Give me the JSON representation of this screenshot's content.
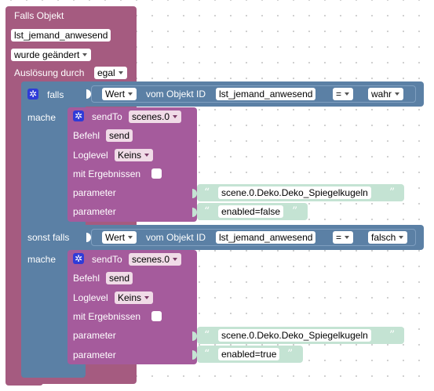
{
  "trigger": {
    "title": "Falls Objekt",
    "object_id": "lst_jemand_anwesend",
    "condition": "wurde geändert",
    "trigger_label": "Auslösung durch",
    "trigger_value": "egal"
  },
  "if_block": {
    "if_label": "falls",
    "do_label": "mache",
    "elseif_label": "sonst falls",
    "gear_symbol": "✲"
  },
  "cond1": {
    "property": "Wert",
    "of_object": "vom Objekt ID",
    "object_id": "lst_jemand_anwesend",
    "operator": "=",
    "value": "wahr"
  },
  "cond2": {
    "property": "Wert",
    "of_object": "vom Objekt ID",
    "object_id": "lst_jemand_anwesend",
    "operator": "=",
    "value": "falsch"
  },
  "send1": {
    "label": "sendTo",
    "target": "scenes.0",
    "command_label": "Befehl",
    "command": "send",
    "loglevel_label": "Loglevel",
    "loglevel": "Keins",
    "results_label": "mit Ergebnissen",
    "param1_label": "parameter",
    "param1_value": "scene.0.Deko.Deko_Spiegelkugeln",
    "param2_label": "parameter",
    "param2_value": "enabled=false"
  },
  "send2": {
    "label": "sendTo",
    "target": "scenes.0",
    "command_label": "Befehl",
    "command": "send",
    "loglevel_label": "Loglevel",
    "loglevel": "Keins",
    "results_label": "mit Ergebnissen",
    "param1_label": "parameter",
    "param1_value": "scene.0.Deko.Deko_Spiegelkugeln",
    "param2_label": "parameter",
    "param2_value": "enabled=true"
  },
  "glyphs": {
    "open_quote": "“",
    "close_quote": "”"
  },
  "colors": {
    "trigger_block": "#a55b80",
    "logic_block": "#5b80a5",
    "sendto_block": "#a55b9c",
    "text_block": "#c4e3d3"
  }
}
